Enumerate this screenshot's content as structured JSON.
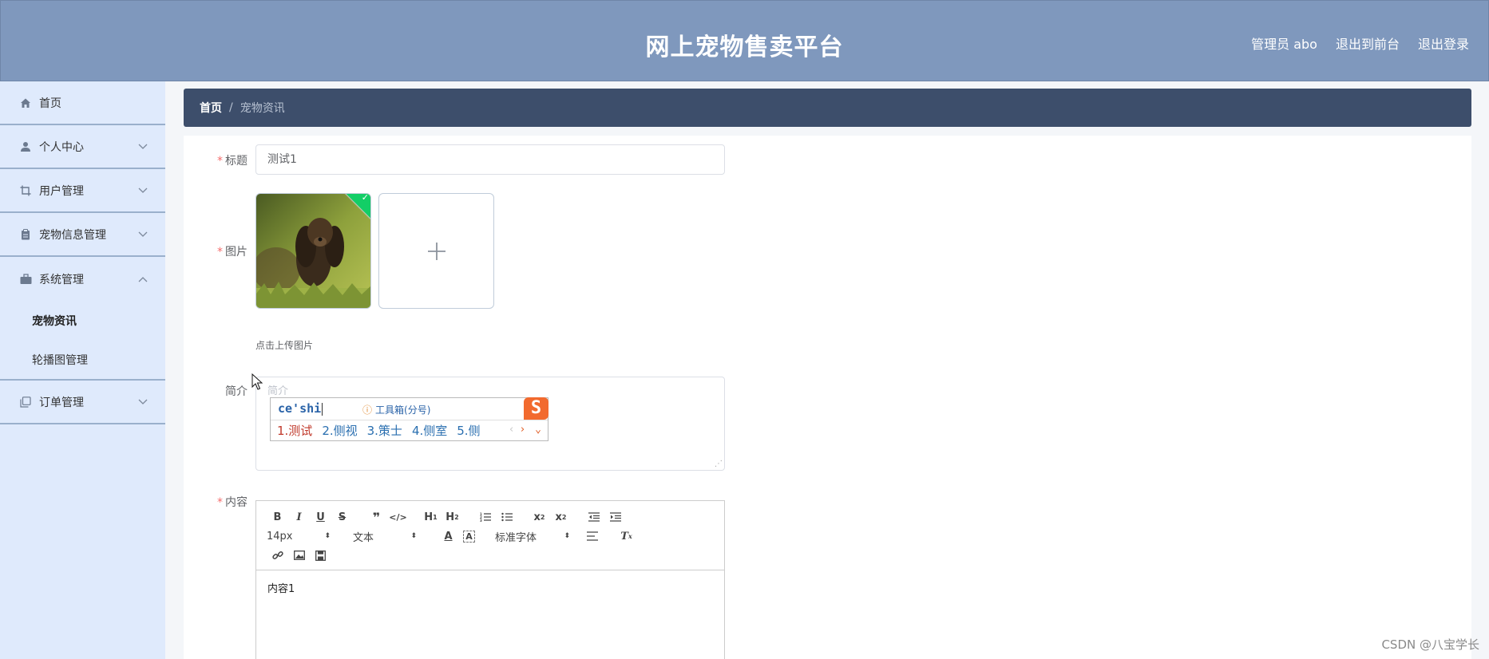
{
  "header": {
    "title": "网上宠物售卖平台",
    "admin_label": "管理员 abo",
    "back_to_front": "退出到前台",
    "logout": "退出登录"
  },
  "sidebar": {
    "items": [
      {
        "label": "首页",
        "icon": "home-icon"
      },
      {
        "label": "个人中心",
        "icon": "user-icon"
      },
      {
        "label": "用户管理",
        "icon": "crop-icon"
      },
      {
        "label": "宠物信息管理",
        "icon": "clipboard-icon"
      },
      {
        "label": "系统管理",
        "icon": "briefcase-icon"
      },
      {
        "label": "订单管理",
        "icon": "copy-icon"
      }
    ],
    "system_subitems": [
      {
        "label": "宠物资讯"
      },
      {
        "label": "轮播图管理"
      }
    ]
  },
  "breadcrumb": {
    "home": "首页",
    "separator": "/",
    "current": "宠物资讯"
  },
  "form": {
    "title_label": "标题",
    "title_value": "测试1",
    "image_label": "图片",
    "upload_tip": "点击上传图片",
    "intro_label": "简介",
    "intro_placeholder": "简介",
    "content_label": "内容",
    "content_value": "内容1",
    "required_mark": "*"
  },
  "ime": {
    "pinyin": "ce'shi",
    "toolbox": "工具箱(分号)",
    "logo": "S",
    "candidates": [
      "1.测试",
      "2.侧视",
      "3.策士",
      "4.侧室",
      "5.侧"
    ]
  },
  "editor_toolbar": {
    "font_size": "14px",
    "text_style": "文本",
    "font_family": "标准字体"
  },
  "watermark": "CSDN @八宝学长"
}
